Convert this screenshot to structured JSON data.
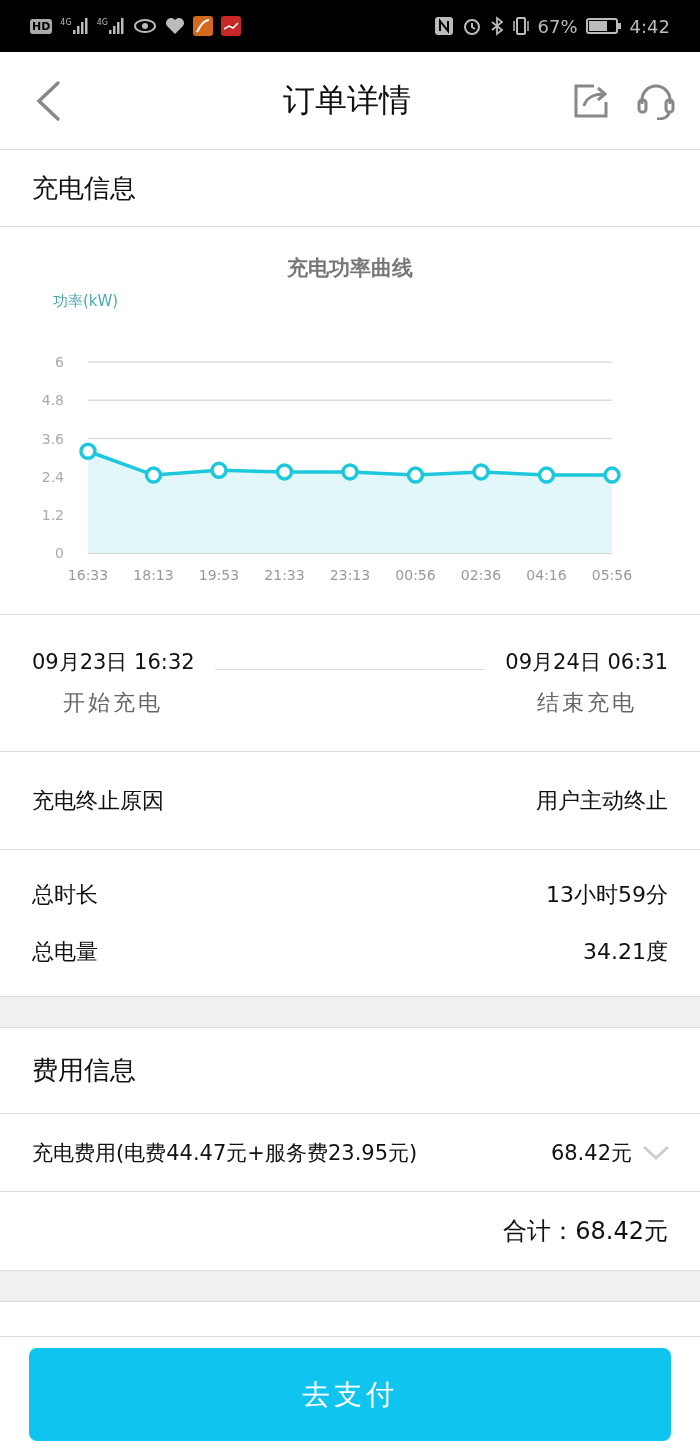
{
  "status_bar": {
    "hd": "HD",
    "networks": [
      "4G",
      "4G"
    ],
    "battery": "67%",
    "time": "4:42"
  },
  "nav": {
    "title": "订单详情"
  },
  "charging": {
    "heading": "充电信息",
    "chart_data": {
      "type": "area",
      "title": "充电功率曲线",
      "ylabel": "功率(kW)",
      "categories": [
        "16:33",
        "18:13",
        "19:53",
        "21:33",
        "23:13",
        "00:56",
        "02:36",
        "04:16",
        "05:56"
      ],
      "series": [
        {
          "color": "#1ec8dc",
          "values": [
            3.2,
            2.45,
            2.6,
            2.55,
            2.55,
            2.45,
            2.55,
            2.45,
            2.45
          ]
        }
      ],
      "ylim": [
        0,
        6
      ],
      "yticks": [
        0,
        1.2,
        2.4,
        3.6,
        4.8,
        6
      ]
    },
    "start": {
      "time": "09月23日 16:32",
      "label": "开始充电"
    },
    "end": {
      "time": "09月24日 06:31",
      "label": "结束充电"
    },
    "reason": {
      "label": "充电终止原因",
      "value": "用户主动终止"
    },
    "totals": [
      {
        "label": "总时长",
        "value": "13小时59分"
      },
      {
        "label": "总电量",
        "value": "34.21度"
      }
    ]
  },
  "fees": {
    "heading": "费用信息",
    "items": [
      {
        "label": "充电费用(电费44.47元+服务费23.95元)",
        "value": "68.42元",
        "expanded": false
      }
    ],
    "total": "合计：68.42元"
  },
  "pay_button": "去支付"
}
